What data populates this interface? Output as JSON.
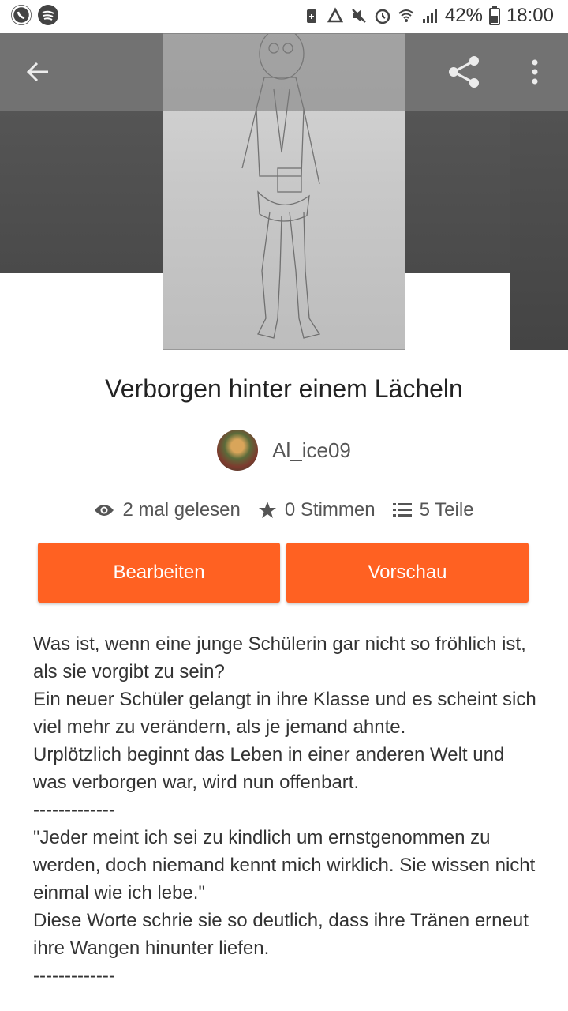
{
  "status_bar": {
    "battery": "42%",
    "time": "18:00"
  },
  "story": {
    "title": "Verborgen hinter einem Lächeln",
    "author": "Al_ice09"
  },
  "stats": {
    "reads": "2 mal gelesen",
    "votes": "0 Stimmen",
    "parts": "5 Teile"
  },
  "buttons": {
    "edit": "Bearbeiten",
    "preview": "Vorschau"
  },
  "description": {
    "lines": [
      "Was ist, wenn eine junge Schülerin gar nicht so fröhlich ist, als sie vorgibt zu sein?",
      "Ein neuer Schüler gelangt in ihre Klasse und es scheint sich viel mehr zu verändern, als je jemand ahnte.",
      "Urplötzlich beginnt das Leben in einer anderen Welt und was verborgen war, wird nun offenbart.",
      "-------------",
      "\"Jeder meint ich sei zu kindlich um ernstgenommen zu werden, doch niemand kennt mich wirklich. Sie wissen nicht einmal wie ich lebe.\"",
      "Diese Worte schrie sie so deutlich, dass ihre Tränen erneut ihre Wangen hinunter liefen.",
      "-------------"
    ]
  },
  "icons": {
    "status_left": [
      "whatsapp-icon",
      "spotify-icon"
    ],
    "status_right": [
      "battery-saver-icon",
      "recycle-icon",
      "mute-icon",
      "alarm-icon",
      "wifi-icon",
      "signal-icon",
      "battery-icon"
    ],
    "toolbar": [
      "back-arrow-icon",
      "share-icon",
      "more-vert-icon"
    ],
    "stats": [
      "eye-icon",
      "star-icon",
      "list-icon"
    ]
  },
  "colors": {
    "accent": "#ff6122",
    "toolbar_overlay": "#787878",
    "text": "#333333"
  }
}
